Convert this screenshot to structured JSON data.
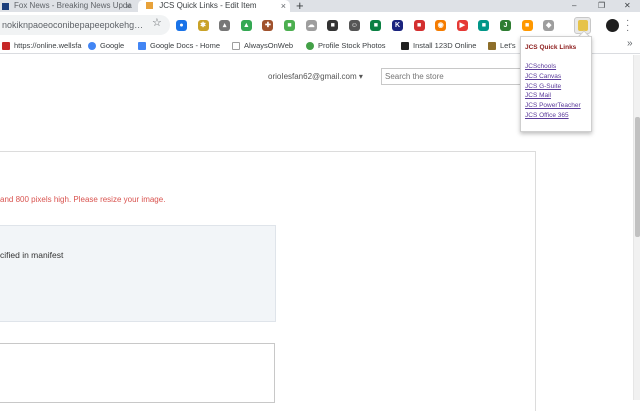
{
  "tabs": [
    {
      "title": "Fox News - Breaking News Upda",
      "close": "×",
      "favicon_color": "#1a3d7c"
    },
    {
      "title": "JCS Quick Links - Edit Item",
      "close": "×",
      "favicon_color": "#e8a23a"
    }
  ],
  "new_tab": "+",
  "window_controls": {
    "minimize": "–",
    "restore": "❐",
    "close": "✕"
  },
  "omnibox": {
    "url": "nokiknpaoeoconibepapeepokehg…"
  },
  "extensions": [
    {
      "name": "ext-blue-circle-icon",
      "color": "#1a73e8",
      "glyph": "●"
    },
    {
      "name": "ext-bee-icon",
      "color": "#c9a227",
      "glyph": "✱"
    },
    {
      "name": "ext-lamp-icon",
      "color": "#777777",
      "glyph": "▴"
    },
    {
      "name": "ext-drive-icon",
      "color": "#34a853",
      "glyph": "▲"
    },
    {
      "name": "ext-puzzle-icon",
      "color": "#a0522d",
      "glyph": "✚"
    },
    {
      "name": "ext-green-icon",
      "color": "#4caf50",
      "glyph": "■"
    },
    {
      "name": "ext-cloud-icon",
      "color": "#9e9e9e",
      "glyph": "☁"
    },
    {
      "name": "ext-dark-icon",
      "color": "#333333",
      "glyph": "■"
    },
    {
      "name": "ext-face-icon",
      "color": "#555555",
      "glyph": "☺"
    },
    {
      "name": "ext-game-icon",
      "color": "#0b8043",
      "glyph": "■"
    },
    {
      "name": "ext-k-icon",
      "color": "#1a237e",
      "glyph": "K"
    },
    {
      "name": "ext-red-icon",
      "color": "#d32f2f",
      "glyph": "■"
    },
    {
      "name": "ext-rss-icon",
      "color": "#f57c00",
      "glyph": "◉"
    },
    {
      "name": "ext-play-icon",
      "color": "#e53935",
      "glyph": "▶"
    },
    {
      "name": "ext-teal-icon",
      "color": "#009688",
      "glyph": "■"
    },
    {
      "name": "ext-jelly-icon",
      "color": "#2e7d32",
      "glyph": "J"
    },
    {
      "name": "ext-orange-icon",
      "color": "#ff9800",
      "glyph": "■"
    },
    {
      "name": "ext-pin-icon",
      "color": "#9e9e9e",
      "glyph": "◆"
    }
  ],
  "bookmarks": [
    {
      "label": "https://online.wellsfa",
      "icon_color": "#c62828"
    },
    {
      "label": "Google",
      "icon_color": "#4285f4"
    },
    {
      "label": "Google Docs - Home",
      "icon_color": "#4285f4"
    },
    {
      "label": "AlwaysOnWeb",
      "icon_color": "#9e9e9e"
    },
    {
      "label": "Profile Stock Photos",
      "icon_color": "#43a047"
    },
    {
      "label": "Install 123D Online",
      "icon_color": "#212121"
    },
    {
      "label": "Let's",
      "icon_color": "#8d6e2a"
    }
  ],
  "page": {
    "email": "orioIesfan62@gmail.com ▾",
    "search_placeholder": "Search the store",
    "error_text": "and 800 pixels high. Please resize your image.",
    "manifest_text": "cified in manifest"
  },
  "popup": {
    "title": "JCS Quick Links",
    "links": [
      "JCSchools",
      "JCS Canvas",
      "JCS G-Suite",
      "JCS Mail",
      "JCS PowerTeacher",
      "JCS Office 365"
    ]
  }
}
